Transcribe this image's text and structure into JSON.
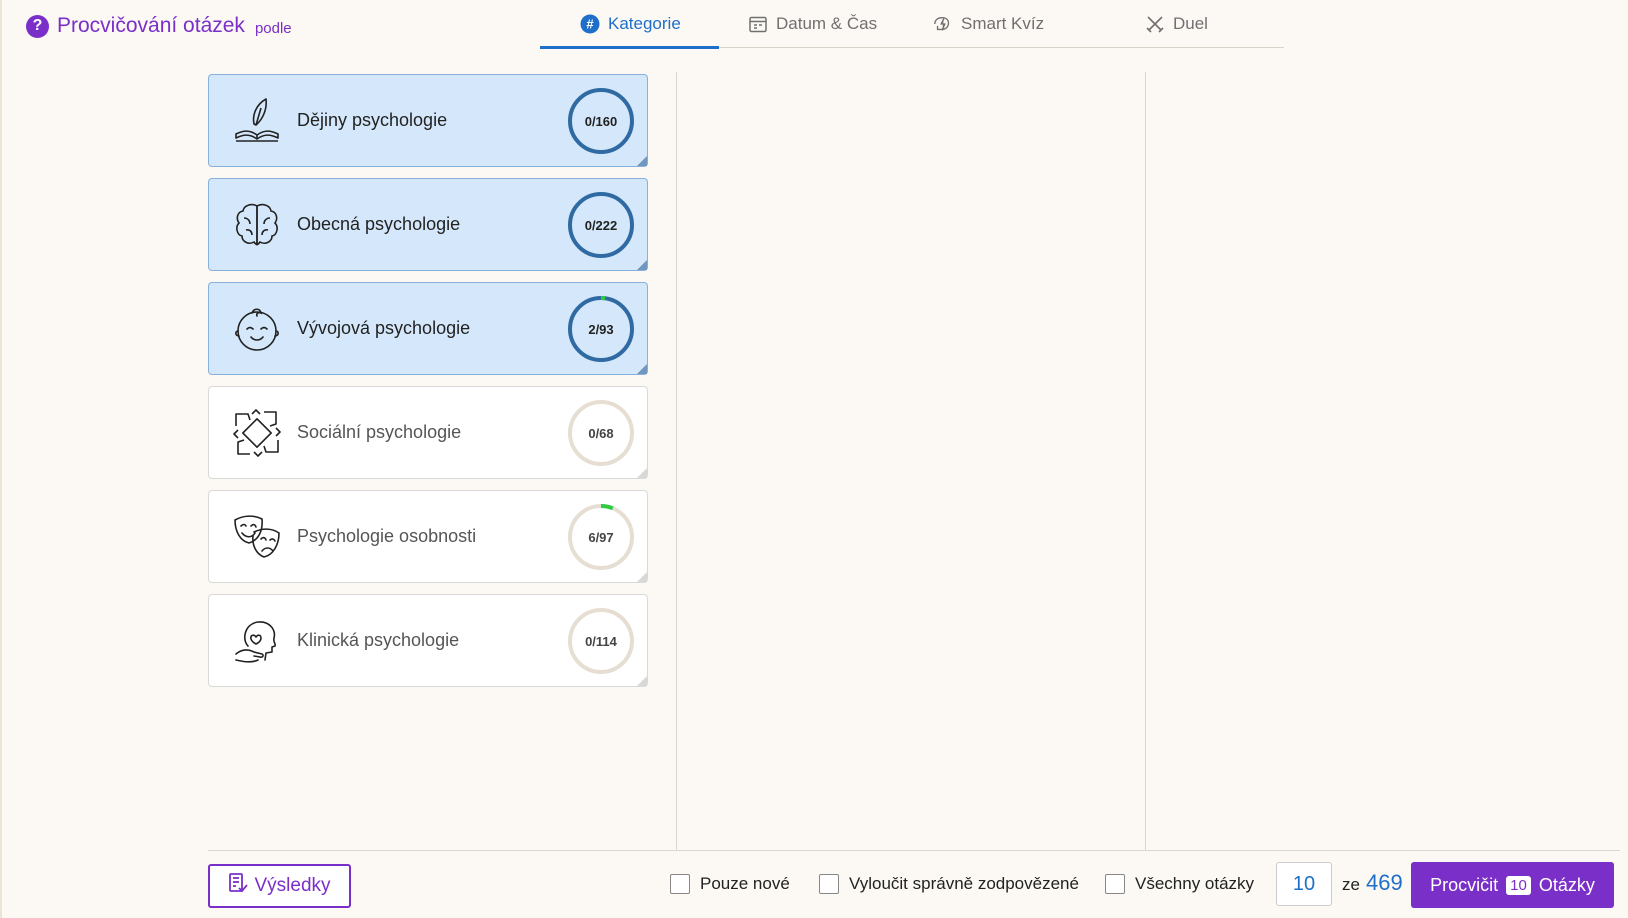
{
  "header": {
    "title": "Procvičování otázek",
    "subtitle": "podle",
    "help_icon": "question-circle-icon"
  },
  "tabs": [
    {
      "label": "Kategorie",
      "icon": "hash-icon",
      "active": true
    },
    {
      "label": "Datum & Čas",
      "icon": "calendar-icon",
      "active": false
    },
    {
      "label": "Smart Kvíz",
      "icon": "lightning-brain-icon",
      "active": false
    },
    {
      "label": "Duel",
      "icon": "crossed-swords-icon",
      "active": false
    }
  ],
  "categories": [
    {
      "label": "Dějiny psychologie",
      "progress": "0/160",
      "done": 0,
      "total": 160,
      "selected": true,
      "icon": "book-quill-icon"
    },
    {
      "label": "Obecná psychologie",
      "progress": "0/222",
      "done": 0,
      "total": 222,
      "selected": true,
      "icon": "brain-icon"
    },
    {
      "label": "Vývojová psychologie",
      "progress": "2/93",
      "done": 2,
      "total": 93,
      "selected": true,
      "icon": "baby-face-icon"
    },
    {
      "label": "Sociální psychologie",
      "progress": "0/68",
      "done": 0,
      "total": 68,
      "selected": false,
      "icon": "joined-hands-icon"
    },
    {
      "label": "Psychologie osobnosti",
      "progress": "6/97",
      "done": 6,
      "total": 97,
      "selected": false,
      "icon": "theater-masks-icon"
    },
    {
      "label": "Klinická psychologie",
      "progress": "0/114",
      "done": 0,
      "total": 114,
      "selected": false,
      "icon": "head-heart-hand-icon"
    }
  ],
  "footer": {
    "results_label": "Výsledky",
    "only_new_label": "Pouze nové",
    "exclude_correct_label": "Vyloučit správně zodpovězené",
    "all_questions_label": "Všechny otázky",
    "question_count": "10",
    "of_label": "ze",
    "total_questions": "469",
    "practice_label": "Procvičit",
    "practice_count": "10",
    "practice_suffix": "Otázky"
  },
  "colors": {
    "brand_purple": "#7b2fc9",
    "accent_blue": "#1e6fc9",
    "ring_selected": "#2f6aa3",
    "ring_unselected": "#e6ded3",
    "progress_green": "#2ecc40",
    "selected_bg": "#d5e8fb"
  }
}
